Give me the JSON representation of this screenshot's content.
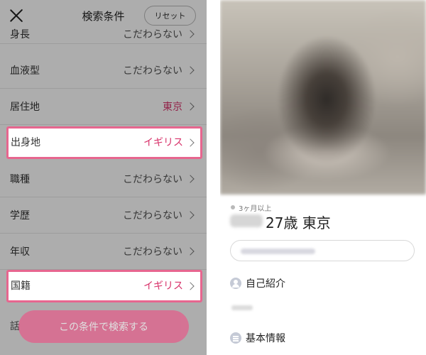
{
  "search_conditions": {
    "title": "検索条件",
    "reset_label": "リセット",
    "rows": [
      {
        "label": "身長",
        "value": "こだわらない"
      },
      {
        "label": "血液型",
        "value": "こだわらない"
      },
      {
        "label": "居住地",
        "value": "東京"
      },
      {
        "label": "出身地",
        "value": "イギリス"
      },
      {
        "label": "職種",
        "value": "こだわらない"
      },
      {
        "label": "学歴",
        "value": "こだわらない"
      },
      {
        "label": "年収",
        "value": "こだわらない"
      },
      {
        "label": "国籍",
        "value": "イギリス"
      }
    ],
    "search_button_label": "この条件で検索する",
    "partial_row_label": "話"
  },
  "profile": {
    "login_status": "3ヶ月以上",
    "age_location": "27歳 東京",
    "sections": [
      {
        "icon": "person-icon",
        "title": "自己紹介"
      },
      {
        "icon": "list-icon",
        "title": "基本情報"
      }
    ]
  },
  "colors": {
    "accent_pink": "#d8326a",
    "button_pink": "#ee4f84",
    "highlight_border": "#e7668f"
  }
}
